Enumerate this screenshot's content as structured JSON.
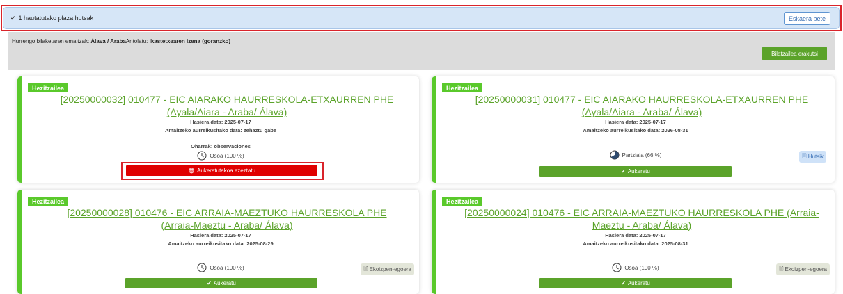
{
  "notification": {
    "check_icon": "check-icon",
    "text": "1 hautatutako plaza hutsak",
    "button_label": "Eskaera bete"
  },
  "filter": {
    "prefix": "Hurrengo bilaketaren emaitzak: ",
    "location": "Álava / Araba",
    "sort_label": "Antolatu: ",
    "sort_value": "Ikastetxearen izena (goranzko)",
    "button_label": "Bilatzailea erakutsi"
  },
  "cards": [
    {
      "badge": "Hezitzailea",
      "title": "[20250000032] 010477 - EIC AIARAKO HAURRESKOLA-ETXAURREN PHE (Ayala/Aiara - Araba/ Álava)",
      "start": "Hasiera data: 2025-07-17",
      "end": "Amaitzeko aurreikusitako data: zehaztu gabe",
      "notes": "Oharrak: observaciones",
      "status": "Osoa (100 %)",
      "action": "Aukeratutakoa ezeztatu"
    },
    {
      "badge": "Hezitzailea",
      "title": "[20250000031] 010477 - EIC AIARAKO HAURRESKOLA-ETXAURREN PHE (Ayala/Aiara - Araba/ Álava)",
      "start": "Hasiera data: 2025-07-17",
      "end": "Amaitzeko aurreikusitako data: 2026-08-31",
      "status": "Partziala (66 %)",
      "action": "Aukeratu",
      "side": "Hutsik"
    },
    {
      "badge": "Hezitzailea",
      "title": "[20250000028] 010476 - EIC ARRAIA-MAEZTUKO HAURRESKOLA PHE (Arraia-Maeztu - Araba/ Álava)",
      "start": "Hasiera data: 2025-07-17",
      "end": "Amaitzeko aurreikusitako data: 2025-08-29",
      "status": "Osoa (100 %)",
      "action": "Aukeratu",
      "side": "Ekoizpen-egoera"
    },
    {
      "badge": "Hezitzailea",
      "title": "[20250000024] 010476 - EIC ARRAIA-MAEZTUKO HAURRESKOLA PHE (Arraia-Maeztu - Araba/ Álava)",
      "start": "Hasiera data: 2025-07-17",
      "end": "Amaitzeko aurreikusitako data: 2025-08-31",
      "status": "Osoa (100 %)",
      "action": "Aukeratu",
      "side": "Ekoizpen-egoera"
    }
  ]
}
